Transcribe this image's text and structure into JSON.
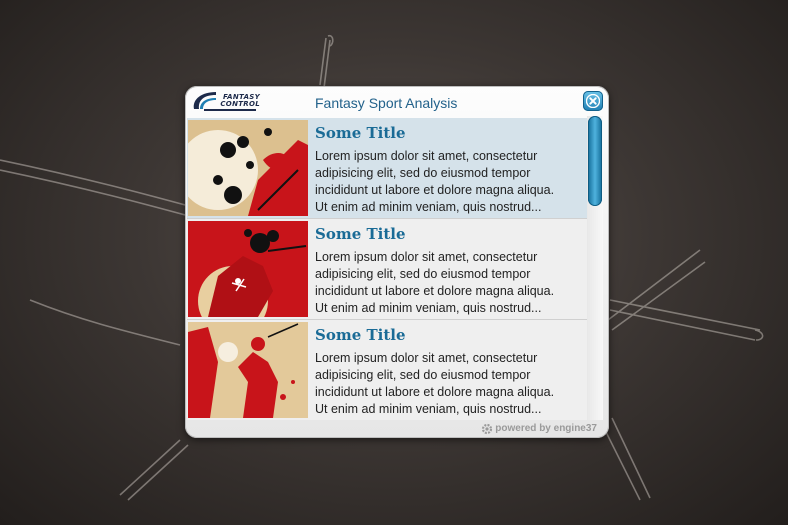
{
  "window": {
    "title": "Fantasy Sport Analysis",
    "logo_line1": "FANTASY",
    "logo_line2": "CONTROL",
    "close_icon": "close-x-icon"
  },
  "items": [
    {
      "title": "Some Title",
      "lines": [
        "Lorem ipsum dolor sit amet, consectetur",
        "adipisicing elit, sed do eiusmod tempor",
        "incididunt ut labore et dolore magna aliqua.",
        "Ut enim ad minim veniam, quis nostrud..."
      ],
      "selected": true
    },
    {
      "title": "Some Title",
      "lines": [
        "Lorem ipsum dolor sit amet, consectetur",
        "adipisicing elit, sed do eiusmod tempor",
        "incididunt ut labore et dolore magna aliqua.",
        "Ut enim ad minim veniam, quis nostrud..."
      ],
      "selected": false
    },
    {
      "title": "Some Title",
      "lines": [
        "Lorem ipsum dolor sit amet, consectetur",
        "adipisicing elit, sed do eiusmod tempor",
        "incididunt ut labore et dolore magna aliqua.",
        "Ut enim ad minim veniam, quis nostrud..."
      ],
      "selected": false
    }
  ],
  "footer": {
    "powered_by": "powered by engine37"
  },
  "colors": {
    "accent": "#1a6b96",
    "selected_row": "#d5e2ea",
    "thumb_red": "#c8141a",
    "thumb_tan": "#d9b98a"
  }
}
